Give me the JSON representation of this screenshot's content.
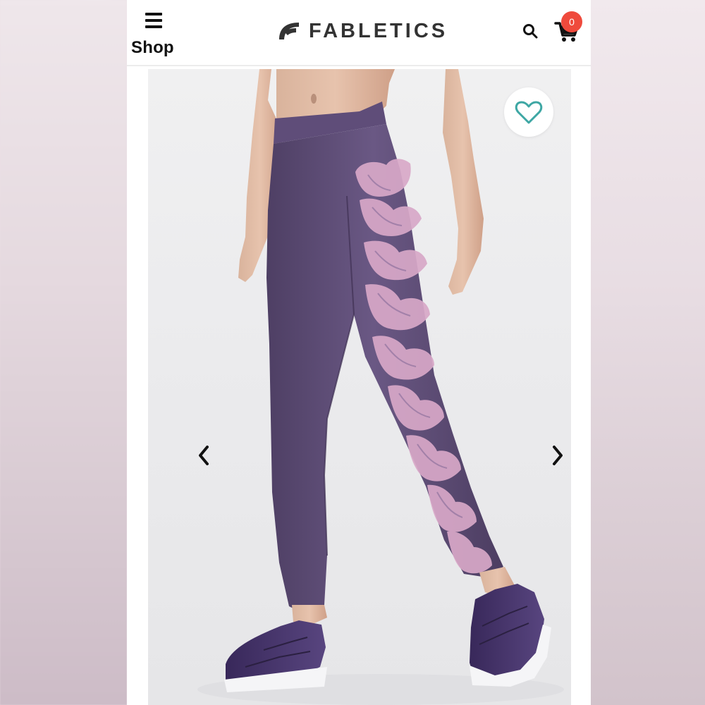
{
  "header": {
    "menu_label": "Shop",
    "brand_name": "FABLETICS",
    "cart_count": "0"
  },
  "icons": {
    "menu": "hamburger-icon",
    "brand": "fabletics-logo",
    "search": "search-icon",
    "cart": "cart-icon",
    "favorite": "heart-icon",
    "prev": "chevron-left-icon",
    "next": "chevron-right-icon"
  },
  "colors": {
    "badge": "#ef4a3c",
    "heart": "#3ea7a4",
    "brand_text": "#333333",
    "leggings": "#5b496f",
    "pattern": "#d7a9c6"
  }
}
